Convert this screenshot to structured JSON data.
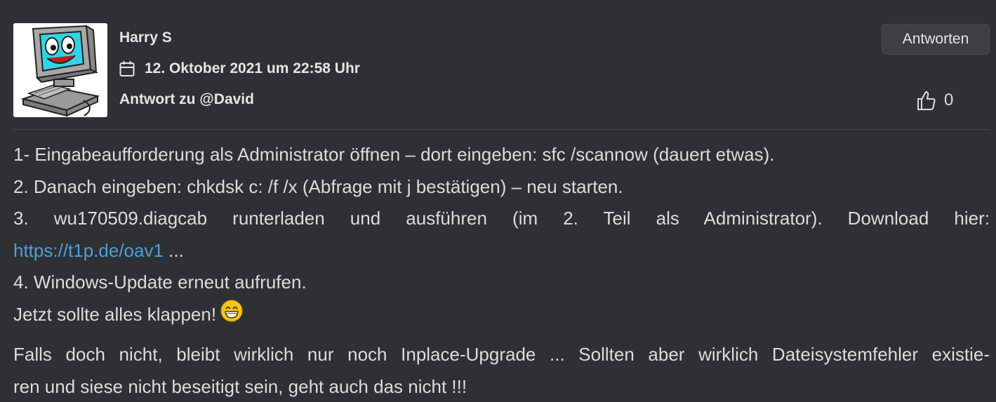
{
  "post": {
    "author": "Harry S",
    "date": "12. Oktober 2021 um 22:58 Uhr",
    "reply_to": "Antwort zu @David",
    "reply_button": "Antworten",
    "like_count": "0"
  },
  "body": {
    "line1": "1- Eingabeaufforderung als Administrator öffnen – dort eingeben: sfc /scannow (dauert etwas).",
    "line2": "2. Danach eingeben: chkdsk c: /f /x (Abfrage mit j bestätigen) – neu starten.",
    "line3": "3. wu170509.diagcab runterladen und ausführen (im 2. Teil als Administrator). Download hier:",
    "link": "https://t1p.de/oav1",
    "link_suffix": " ...",
    "line5": "4. Windows-Update erneut aufrufen.",
    "line6": "Jetzt sollte alles klappen!",
    "para2_line1": "Falls doch nicht, bleibt wirklich nur noch Inplace-Upgrade ... Sollten aber wirklich Dateisystemfehler existie-",
    "para2_line2": "ren und siese nicht beseitigt sein, geht auch das nicht !!!"
  },
  "icons": {
    "calendar": "calendar-icon",
    "like": "thumbs-up-icon",
    "emoji": "grinning-face-emoji"
  },
  "colors": {
    "background": "#2f3033",
    "link": "#4a9fe0",
    "button_bg": "#3d3f43"
  }
}
